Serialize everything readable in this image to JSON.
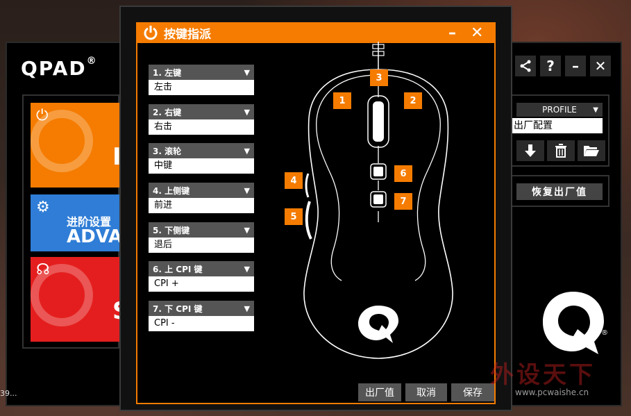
{
  "main": {
    "logo": "QPAD",
    "logo_mark": "®",
    "tiles": [
      {
        "name": "power",
        "cut_text": "I"
      },
      {
        "name": "advanced",
        "line1": "进阶设置",
        "line2": "ADVA"
      },
      {
        "name": "support",
        "cut_text": "S"
      }
    ],
    "top_buttons": [
      "share",
      "help",
      "minimize",
      "close"
    ],
    "profile": {
      "label": "PROFILE",
      "value": "出厂配置"
    },
    "restore_button": "恢复出厂值",
    "brand_q_mark": "®"
  },
  "dialog": {
    "title": "按键指派",
    "key_assignments": [
      {
        "label": "1. 左键",
        "value": "左击"
      },
      {
        "label": "2. 右键",
        "value": "右击"
      },
      {
        "label": "3. 滚轮",
        "value": "中键"
      },
      {
        "label": "4. 上侧键",
        "value": "前进"
      },
      {
        "label": "5. 下侧键",
        "value": "退后"
      },
      {
        "label": "6. 上 CPI 键",
        "value": "CPI +"
      },
      {
        "label": "7. 下 CPI 键",
        "value": "CPI -"
      }
    ],
    "mouse_badges": [
      "1",
      "2",
      "3",
      "4",
      "5",
      "6",
      "7"
    ],
    "buttons": {
      "factory": "出厂值",
      "cancel": "取消",
      "save": "保存"
    }
  },
  "watermark": {
    "text": "外设天下",
    "url": "www.pcwaishe.cn"
  },
  "left_edge_text": "39..."
}
